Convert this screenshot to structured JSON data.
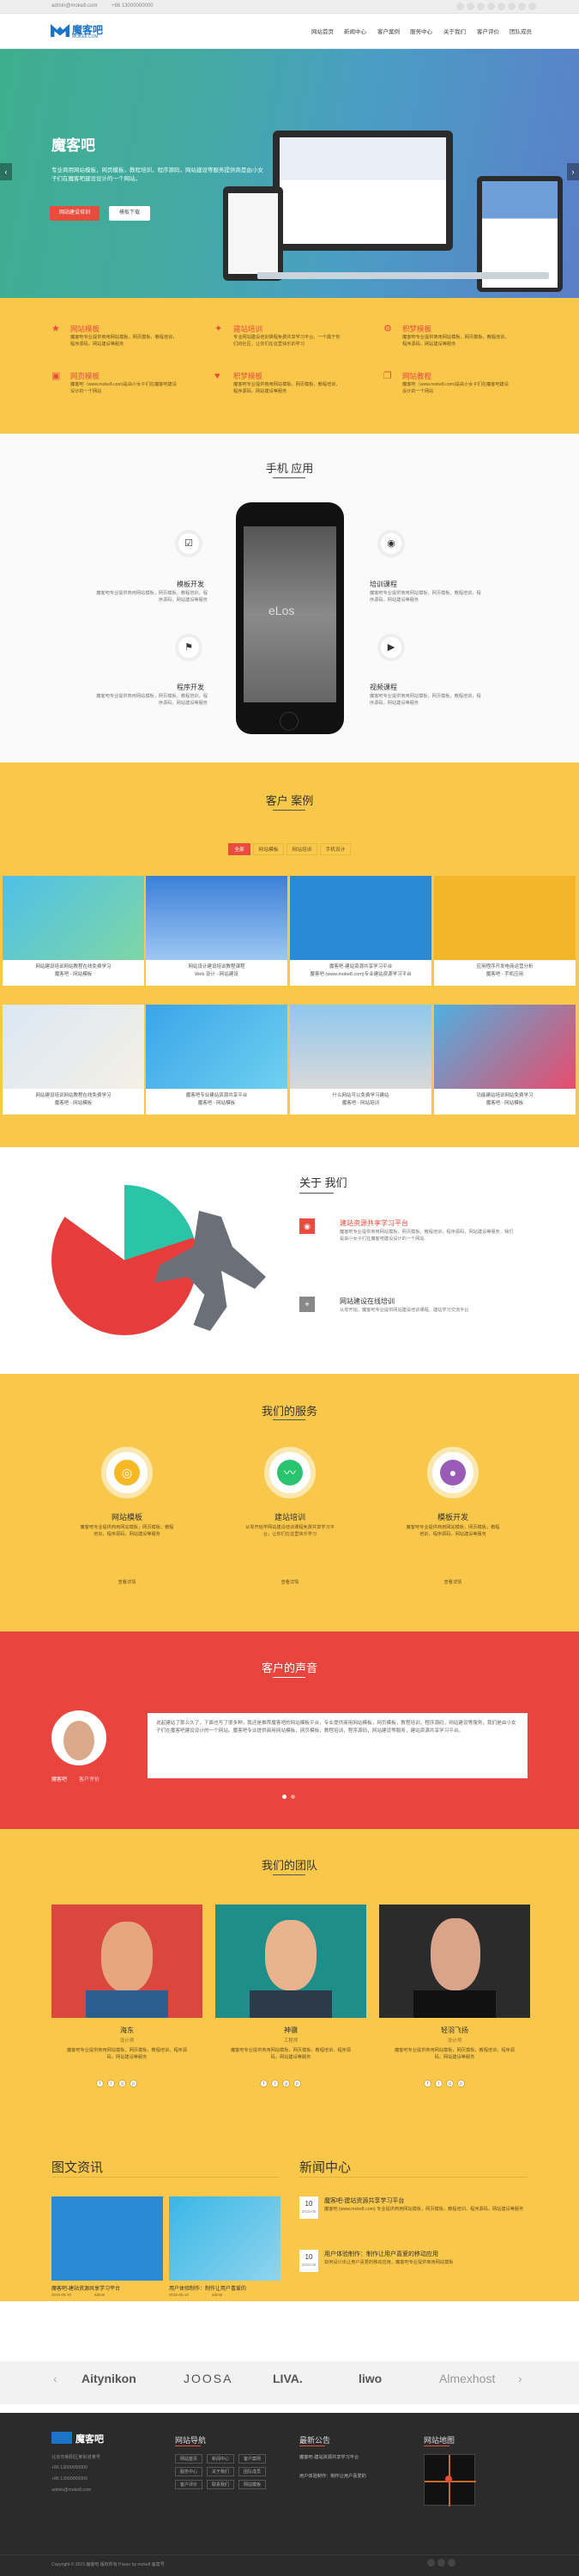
{
  "topbar": {
    "email": "admin@moke8.com",
    "phone": "+86 13000000000",
    "social_icons": [
      "facebook-icon",
      "twitter-icon",
      "google-plus-icon",
      "linkedin-icon",
      "pinterest-icon",
      "vimeo-icon",
      "youtube-icon",
      "rss-icon"
    ]
  },
  "header": {
    "logo_text": "魔客吧",
    "logo_sub": "MOKE8.COM",
    "nav": [
      "网站首页",
      "新闻中心",
      "客户案例",
      "服务中心",
      "关于我们",
      "客户评价",
      "团队成员"
    ]
  },
  "hero": {
    "title": "魔客吧",
    "desc": "专业商用网站模板，网页模板，教程培训，程序源码，网站建设等服务提供商是由小女子们在魔客吧建设设计的一个网站。",
    "btn_primary": "网站建设培训",
    "btn_secondary": "模板下载",
    "prev": "‹",
    "next": "›"
  },
  "features": [
    {
      "icon": "star-icon",
      "title": "网站模板",
      "desc": "魔客吧专业提供商用网站模板，网页模板，教程培训，程序源码，网站建设等服务"
    },
    {
      "icon": "fire-icon",
      "title": "建站培训",
      "desc": "专业网站建设培训课程免费共享学习平台，一个属于你们的社区，让你们在这里快乐的学习"
    },
    {
      "icon": "gear-icon",
      "title": "积梦模板",
      "desc": "魔客吧专业提供商用网站模板，网页模板，教程培训，程序源码，网站建设等服务"
    },
    {
      "icon": "image-icon",
      "title": "网页模板",
      "desc": "魔客吧（www.moke8.com)是由小女子们在魔客吧建设设计的一个网站"
    },
    {
      "icon": "heart-icon",
      "title": "积梦模板",
      "desc": "魔客吧专业提供商用网站模板，网页模板，教程培训，程序源码，网站建设等服务"
    },
    {
      "icon": "book-icon",
      "title": "网站教程",
      "desc": "魔客吧（www.moke8.com)是由小女子们在魔客吧建设设计的一个网站"
    }
  ],
  "mobile": {
    "heading": "手机 应用",
    "items": [
      {
        "icon": "checkbox-icon",
        "title": "模板开发",
        "desc": "魔客吧专业提供商用网站模板，网页模板，教程培训，程序源码，网站建设等服务"
      },
      {
        "icon": "flag-icon",
        "title": "程序开发",
        "desc": "魔客吧专业提供商用网站模板，网页模板，教程培训，程序源码，网站建设等服务"
      },
      {
        "icon": "camera-icon",
        "title": "培训课程",
        "desc": "魔客吧专业提供商用网站模板，网页模板，教程培训，程序源码，网站建设等服务"
      },
      {
        "icon": "video-icon",
        "title": "视频课程",
        "desc": "魔客吧专业提供商用网站模板，网页模板，教程培训，程序源码，网站建设等服务"
      }
    ],
    "phone_brand": "eLos"
  },
  "cases": {
    "heading": "客户 案例",
    "tabs": [
      "全部",
      "网站模板",
      "网站培训",
      "手机设计"
    ],
    "items": [
      {
        "title": "网站建设培训网站教程在线免费学习",
        "sub": "魔客吧 - 网站模板"
      },
      {
        "title": "网站设计建设培训教程课程",
        "sub": "Web 设计 - 网站建设"
      },
      {
        "title": "魔客吧-建站资源共享学习平台",
        "sub": "魔客吧 (www.moke8.com)专业建站资源学习平台"
      },
      {
        "title": "应用程序开发电商运营分析",
        "sub": "魔客吧 - 手机应用"
      },
      {
        "title": "网站建设培训网站教程在线免费学习",
        "sub": "魔客吧 - 网站模板"
      },
      {
        "title": "魔客吧专业建站资源共享平台",
        "sub": "魔客吧 - 网站模板"
      },
      {
        "title": "什么网站可以免费学习建站",
        "sub": "魔客吧 - 网站培训"
      },
      {
        "title": "功能建站培训网站免费学习",
        "sub": "魔客吧 - 网站模板"
      }
    ]
  },
  "about": {
    "heading": "关于 我们",
    "items": [
      {
        "icon": "map-pin-icon",
        "title": "建站资源共享学习平台",
        "desc": "魔客吧专业提供商用网站模板，网页模板，教程培训，程序源码，网站建设等服务，我们是由小女子们在魔客吧建设设计的一个网站"
      },
      {
        "icon": "pin-icon",
        "title": "网站建设在线培训",
        "desc": "从零开始，魔客吧专业提供网站建设培训课程，建站学习交流平台"
      }
    ]
  },
  "services": {
    "heading": "我们的服务",
    "items": [
      {
        "icon": "location-icon",
        "title": "网站模板",
        "desc": "魔客吧专业提供商用网站模板，网页模板，教程培训，程序源码，网站建设等服务",
        "more": "查看详情"
      },
      {
        "icon": "pulse-icon",
        "title": "建站培训",
        "desc": "从零开始学网站建设培训课程免费共享学习平台，让你们在这里快乐学习",
        "more": "查看详情"
      },
      {
        "icon": "user-icon",
        "title": "模板开发",
        "desc": "魔客吧专业提供商用网站模板，网页模板，教程培训，程序源码，网站建设等服务",
        "more": "查看详情"
      }
    ]
  },
  "testimonials": {
    "heading": "客户的声音",
    "name": "魔客吧",
    "role": "客户评价",
    "quote": "说起建站了那么久了，下面也写了很多种，我还是推荐魔客吧的网站模板平台，专业提供商用网站模板，网页模板，教程培训，程序源码，网站建设等服务，我们是由小女子们在魔客吧建设设计的一个网站。魔客吧专业提供商用网站模板，网页模板，教程培训，程序源码，网站建设等服务，建站资源共享学习平台。"
  },
  "team": {
    "heading": "我们的团队",
    "members": [
      {
        "name": "海东",
        "role": "设计师",
        "desc": "魔客吧专业提供商用网站模板，网页模板，教程培训，程序源码，网站建设等服务"
      },
      {
        "name": "神骥",
        "role": "工程师",
        "desc": "魔客吧专业提供商用网站模板，网页模板，教程培训，程序源码，网站建设等服务"
      },
      {
        "name": "轻羽飞扬",
        "role": "设计师",
        "desc": "魔客吧专业提供商用网站模板，网页模板，教程培训，程序源码，网站建设等服务"
      }
    ]
  },
  "news": {
    "left_heading": "图文资讯",
    "right_heading": "新闻中心",
    "pic_items": [
      {
        "title": "魔客吧-建站资源共享学习平台",
        "date": "2015-05-10",
        "author": "admin"
      },
      {
        "title": "用户体验制作：制作让用户喜爱的",
        "date": "2015-05-10",
        "author": "admin"
      }
    ],
    "list_items": [
      {
        "day": "10",
        "month": "2015-05",
        "title": "魔客吧-建站资源共享学习平台",
        "desc": "魔客吧 (www.moke8.com) 专业提供商用网站模板，网页模板，教程培训，程序源码，网站建设等服务"
      },
      {
        "day": "10",
        "month": "2015-05",
        "title": "用户体验制作：制作让用户喜爱的移动应用",
        "desc": "如何设计出让用户喜爱的移动应用，魔客吧专业提供商用网站模板"
      }
    ]
  },
  "partners": [
    "Aitynikon",
    "JOOSA",
    "LIVA.",
    "liwo",
    "Almexhost"
  ],
  "footer": {
    "logo_text": "魔客吧",
    "contact": [
      "北京市朝阳区某街道某号",
      "+86 13000000000",
      "+86 13000000000",
      "admin@moke8.com"
    ],
    "nav_heading": "网站导航",
    "nav_tags": [
      "网站首页",
      "新闻中心",
      "客户案例",
      "服务中心",
      "关于我们",
      "团队成员",
      "客户评价",
      "联系我们",
      "网站模板"
    ],
    "news_heading": "最新公告",
    "news_items": [
      "魔客吧-建站资源共享学习平台",
      "用户体验制作：制作让用户喜爱的"
    ],
    "map_heading": "网站地图",
    "copyright": "Copyright © 2015 魔客吧 版权所有 Power by moke8 备案号"
  }
}
